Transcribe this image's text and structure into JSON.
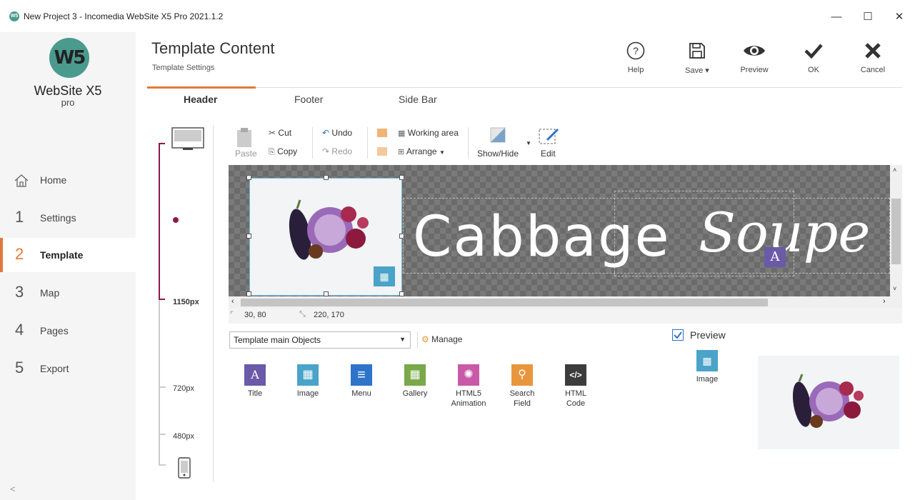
{
  "window": {
    "title": "New Project 3 - Incomedia WebSite X5 Pro 2021.1.2",
    "app_icon": "W5",
    "controls": [
      "minimize-icon",
      "maximize-icon",
      "close-icon"
    ]
  },
  "sidebar": {
    "logo_mark": "W5",
    "logo_text": "WebSite X5",
    "logo_sub": "pro",
    "items": [
      {
        "num": "",
        "label": "Home",
        "icon": "home-icon"
      },
      {
        "num": "1",
        "label": "Settings"
      },
      {
        "num": "2",
        "label": "Template",
        "active": true
      },
      {
        "num": "3",
        "label": "Map"
      },
      {
        "num": "4",
        "label": "Pages"
      },
      {
        "num": "5",
        "label": "Export"
      }
    ],
    "collapse": "<",
    "accent_color": "#e07a3c",
    "brand_color": "#4a9a8e"
  },
  "header": {
    "title": "Template Content",
    "subtitle": "Template Settings",
    "buttons": [
      {
        "label": "Help",
        "icon": "help-icon"
      },
      {
        "label": "Save ▾",
        "icon": "save-icon"
      },
      {
        "label": "Preview",
        "icon": "eye-icon"
      },
      {
        "label": "OK",
        "icon": "check-icon"
      },
      {
        "label": "Cancel",
        "icon": "x-icon"
      }
    ]
  },
  "tabs": [
    {
      "label": "Header",
      "active": true
    },
    {
      "label": "Footer"
    },
    {
      "label": "Side Bar"
    }
  ],
  "ruler": {
    "labels": [
      "1150px",
      "720px",
      "480px"
    ],
    "color": "#8b1a4e"
  },
  "toolbar": {
    "paste": "Paste",
    "cut": "Cut",
    "copy": "Copy",
    "undo": "Undo",
    "redo": "Redo",
    "working_area": "Working area",
    "arrange": "Arrange",
    "show_hide": "Show/Hide",
    "edit": "Edit"
  },
  "canvas": {
    "logo_text": "Cabbage",
    "logo_script": "Soupe"
  },
  "coords": {
    "position": "30, 80",
    "size": "220, 170"
  },
  "objects": {
    "select_value": "Template main Objects",
    "manage": "Manage",
    "items": [
      {
        "label": "Title",
        "color": "#6b5aa8",
        "glyph": "A"
      },
      {
        "label": "Image",
        "color": "#4aa3c8",
        "glyph": "▦"
      },
      {
        "label": "Menu",
        "color": "#2e74c9",
        "glyph": "≡"
      },
      {
        "label": "Gallery",
        "color": "#7aa84a",
        "glyph": "▦"
      },
      {
        "label": "HTML5\nAnimation",
        "color": "#c85aa8",
        "glyph": "✺"
      },
      {
        "label": "Search\nField",
        "color": "#e8963c",
        "glyph": "⚲"
      },
      {
        "label": "HTML\nCode",
        "color": "#3c3c3c",
        "glyph": "</>"
      }
    ]
  },
  "preview": {
    "label": "Preview",
    "checked": true,
    "object_label": "Image"
  }
}
